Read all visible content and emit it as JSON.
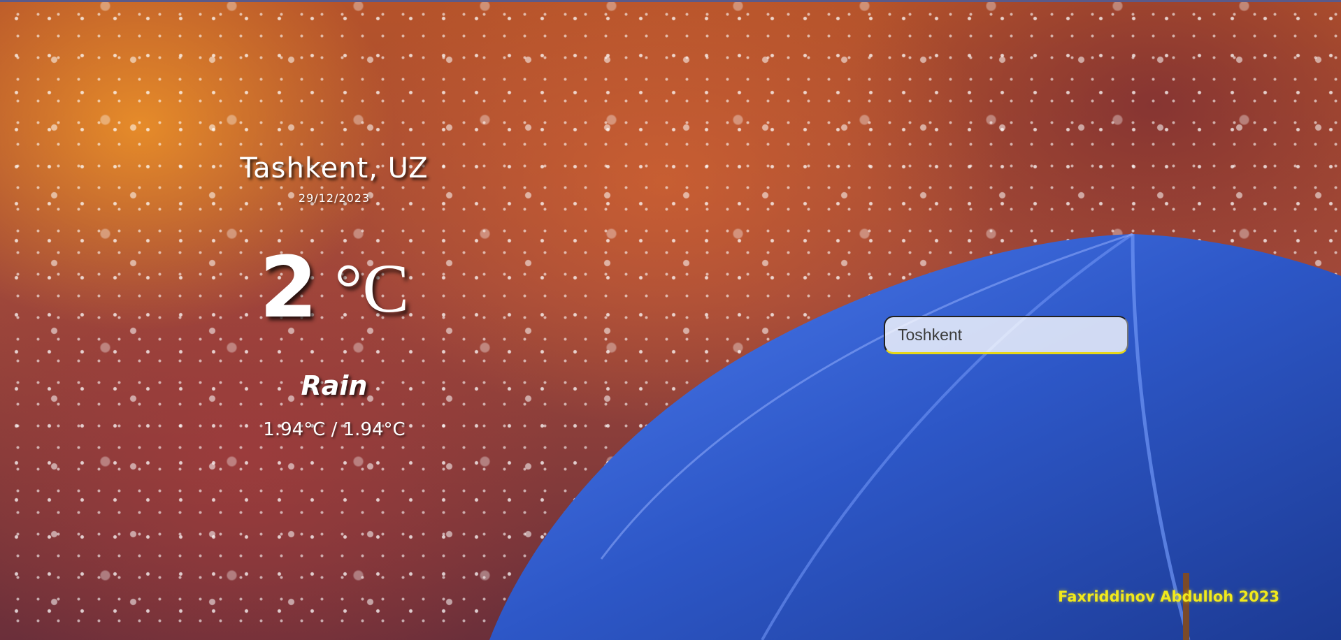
{
  "weather": {
    "city": "Tashkent, UZ",
    "date": "29/12/2023",
    "temperature": "2",
    "unit": "°C",
    "condition": "Rain",
    "range": "1.94°C / 1.94°C"
  },
  "search": {
    "value": "Toshkent",
    "placeholder": ""
  },
  "footer": {
    "credit": "Faxriddinov Abdulloh 2023"
  },
  "colors": {
    "text": "#ffffff",
    "accent": "#e6d61a",
    "credit": "#f2ea1b",
    "umbrella": "#2f5bd0"
  },
  "background": {
    "scene": "rain-umbrella-background"
  }
}
